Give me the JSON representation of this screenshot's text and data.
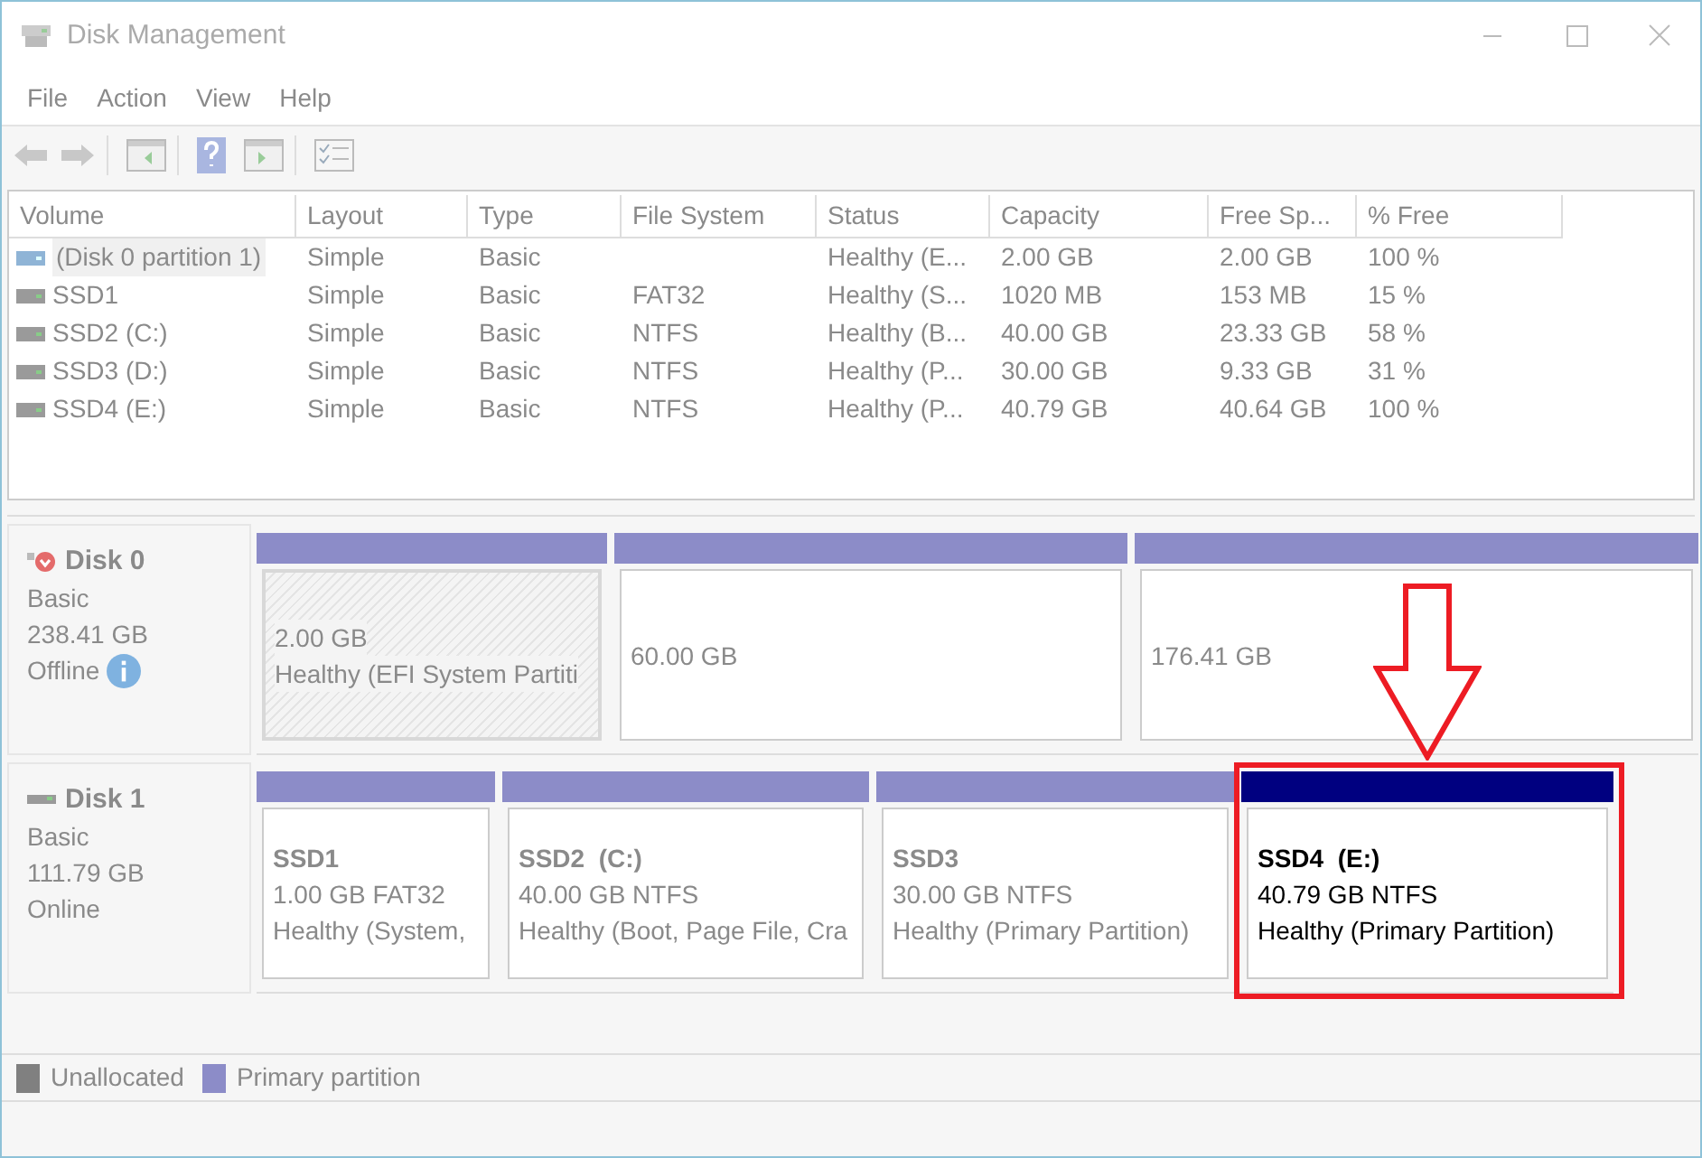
{
  "window": {
    "title": "Disk Management"
  },
  "menu": [
    "File",
    "Action",
    "View",
    "Help"
  ],
  "table": {
    "columns": [
      "Volume",
      "Layout",
      "Type",
      "File System",
      "Status",
      "Capacity",
      "Free Sp...",
      "% Free"
    ],
    "rows": [
      {
        "selected": true,
        "cells": [
          "(Disk 0 partition 1)",
          "Simple",
          "Basic",
          "",
          "Healthy (E...",
          "2.00 GB",
          "2.00 GB",
          "100 %"
        ]
      },
      {
        "selected": false,
        "cells": [
          "SSD1",
          "Simple",
          "Basic",
          "FAT32",
          "Healthy (S...",
          "1020 MB",
          "153 MB",
          "15 %"
        ]
      },
      {
        "selected": false,
        "cells": [
          "SSD2 (C:)",
          "Simple",
          "Basic",
          "NTFS",
          "Healthy (B...",
          "40.00 GB",
          "23.33 GB",
          "58 %"
        ]
      },
      {
        "selected": false,
        "cells": [
          "SSD3 (D:)",
          "Simple",
          "Basic",
          "NTFS",
          "Healthy (P...",
          "30.00 GB",
          "9.33 GB",
          "31 %"
        ]
      },
      {
        "selected": false,
        "cells": [
          "SSD4 (E:)",
          "Simple",
          "Basic",
          "NTFS",
          "Healthy (P...",
          "40.79 GB",
          "40.64 GB",
          "100 %"
        ]
      }
    ]
  },
  "disks": [
    {
      "name": "Disk 0",
      "type": "Basic",
      "size": "238.41 GB",
      "status": "Offline",
      "offline": true,
      "partitions": [
        {
          "selected": true,
          "emphasized": false,
          "annotated": false,
          "lines": [
            "2.00 GB",
            "Healthy (EFI System Partiti"
          ]
        },
        {
          "selected": false,
          "emphasized": false,
          "annotated": false,
          "lines": [
            "60.00 GB"
          ]
        },
        {
          "selected": false,
          "emphasized": false,
          "annotated": false,
          "lines": [
            "176.41 GB"
          ]
        }
      ]
    },
    {
      "name": "Disk 1",
      "type": "Basic",
      "size": "111.79 GB",
      "status": "Online",
      "offline": false,
      "partitions": [
        {
          "selected": false,
          "emphasized": false,
          "annotated": false,
          "label": "SSD1",
          "lines": [
            "1.00 GB FAT32",
            "Healthy (System,"
          ]
        },
        {
          "selected": false,
          "emphasized": false,
          "annotated": false,
          "label": "SSD2  (C:)",
          "lines": [
            "40.00 GB NTFS",
            "Healthy (Boot, Page File, Cra"
          ]
        },
        {
          "selected": false,
          "emphasized": false,
          "annotated": false,
          "label": "SSD3",
          "lines": [
            "30.00 GB NTFS",
            "Healthy (Primary Partition)"
          ]
        },
        {
          "selected": false,
          "emphasized": true,
          "annotated": true,
          "label": "SSD4  (E:)",
          "lines": [
            "40.79 GB NTFS",
            "Healthy (Primary Partition)"
          ]
        }
      ]
    }
  ],
  "legend": [
    {
      "label": "Unallocated",
      "color": "#808080"
    },
    {
      "label": "Primary partition",
      "color": "#8c8cc8"
    }
  ]
}
